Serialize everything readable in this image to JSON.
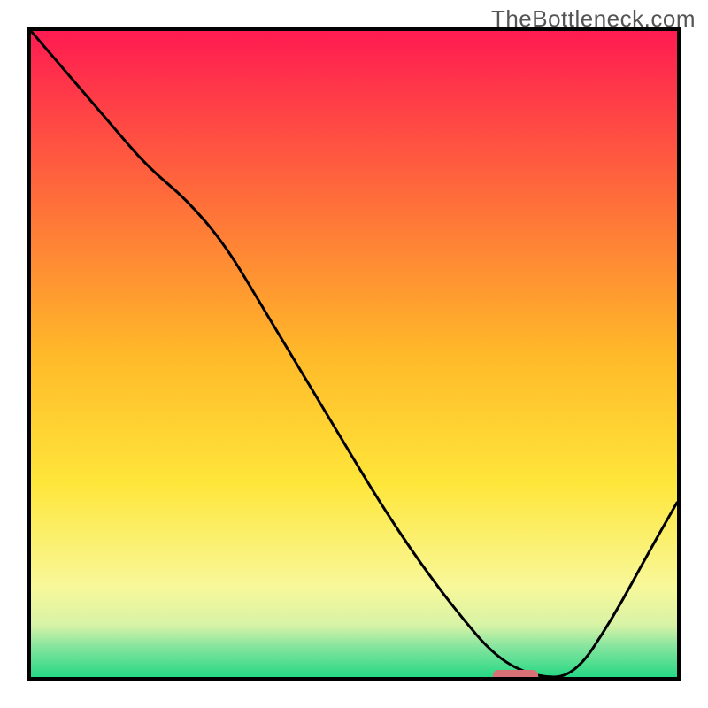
{
  "watermark": "TheBottleneck.com",
  "chart_data": {
    "type": "line",
    "title": "",
    "xlabel": "",
    "ylabel": "",
    "ylim": [
      0,
      100
    ],
    "xlim": [
      0,
      100
    ],
    "gradient_stops": [
      {
        "offset": 0,
        "color": "#ff1b51"
      },
      {
        "offset": 25,
        "color": "#ff6a3b"
      },
      {
        "offset": 50,
        "color": "#ffb929"
      },
      {
        "offset": 70,
        "color": "#ffe63a"
      },
      {
        "offset": 86,
        "color": "#f8f89a"
      },
      {
        "offset": 92,
        "color": "#d7f3a6"
      },
      {
        "offset": 95,
        "color": "#8ce6a0"
      },
      {
        "offset": 100,
        "color": "#26d884"
      }
    ],
    "series": [
      {
        "name": "bottleneck-curve",
        "x": [
          0,
          6,
          12,
          18,
          24,
          30,
          36,
          42,
          48,
          54,
          60,
          66,
          72,
          78,
          84,
          90,
          96,
          100
        ],
        "y": [
          100,
          93,
          86,
          79,
          74,
          67,
          57,
          47,
          37,
          27,
          18,
          10,
          3,
          0,
          0,
          9,
          20,
          27
        ]
      }
    ],
    "indicator": {
      "x": 75,
      "y": 0,
      "width": 7,
      "height": 2.2,
      "color": "#d87076"
    }
  }
}
